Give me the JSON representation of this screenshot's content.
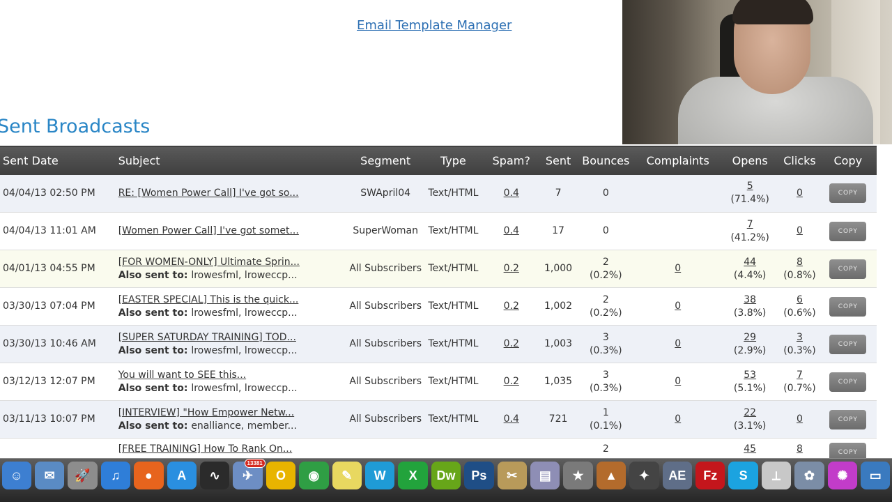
{
  "top_link": "Email Template Manager",
  "section_title": "Sent Broadcasts",
  "columns": [
    "Sent Date",
    "Subject",
    "Segment",
    "Type",
    "Spam?",
    "Sent",
    "Bounces",
    "Complaints",
    "Opens",
    "Clicks",
    "Copy"
  ],
  "copy_label": "COPY",
  "also_label": "Also sent to:",
  "rows": [
    {
      "date": "04/04/13 02:50 PM",
      "subject": "RE: [Women Power Call] I've got so...",
      "also": "",
      "segment": "SWApril04",
      "type": "Text/HTML",
      "spam": "0.4",
      "sent": "7",
      "bounces": "0",
      "bounces_pct": "",
      "complaints": "",
      "opens": "5",
      "opens_pct": "(71.4%)",
      "clicks": "0",
      "clicks_pct": "",
      "style": "odd"
    },
    {
      "date": "04/04/13 11:01 AM",
      "subject": "[Women Power Call] I've got somet...",
      "also": "",
      "segment": "SuperWoman",
      "type": "Text/HTML",
      "spam": "0.4",
      "sent": "17",
      "bounces": "0",
      "bounces_pct": "",
      "complaints": "",
      "opens": "7",
      "opens_pct": "(41.2%)",
      "clicks": "0",
      "clicks_pct": "",
      "style": "even"
    },
    {
      "date": "04/01/13 04:55 PM",
      "subject": "[FOR WOMEN-ONLY] Ultimate Sprin...",
      "also": "lrowesfml, lroweccp...",
      "segment": "All Subscribers",
      "type": "Text/HTML",
      "spam": "0.2",
      "sent": "1,000",
      "bounces": "2",
      "bounces_pct": "(0.2%)",
      "complaints": "0",
      "opens": "44",
      "opens_pct": "(4.4%)",
      "clicks": "8",
      "clicks_pct": "(0.8%)",
      "style": "hl"
    },
    {
      "date": "03/30/13 07:04 PM",
      "subject": "[EASTER SPECIAL] This is the quick...",
      "also": "lrowesfml, lroweccp...",
      "segment": "All Subscribers",
      "type": "Text/HTML",
      "spam": "0.2",
      "sent": "1,002",
      "bounces": "2",
      "bounces_pct": "(0.2%)",
      "complaints": "0",
      "opens": "38",
      "opens_pct": "(3.8%)",
      "clicks": "6",
      "clicks_pct": "(0.6%)",
      "style": "even"
    },
    {
      "date": "03/30/13 10:46 AM",
      "subject": "[SUPER SATURDAY TRAINING] TOD...",
      "also": "lrowesfml, lroweccp...",
      "segment": "All Subscribers",
      "type": "Text/HTML",
      "spam": "0.2",
      "sent": "1,003",
      "bounces": "3",
      "bounces_pct": "(0.3%)",
      "complaints": "0",
      "opens": "29",
      "opens_pct": "(2.9%)",
      "clicks": "3",
      "clicks_pct": "(0.3%)",
      "style": "odd"
    },
    {
      "date": "03/12/13 12:07 PM",
      "subject": "You will want to SEE this...",
      "also": "lrowesfml, lroweccp...",
      "segment": "All Subscribers",
      "type": "Text/HTML",
      "spam": "0.2",
      "sent": "1,035",
      "bounces": "3",
      "bounces_pct": "(0.3%)",
      "complaints": "0",
      "opens": "53",
      "opens_pct": "(5.1%)",
      "clicks": "7",
      "clicks_pct": "(0.7%)",
      "style": "even"
    },
    {
      "date": "03/11/13 10:07 PM",
      "subject": "[INTERVIEW] \"How Empower Netw...",
      "also": "enalliance, member...",
      "segment": "All Subscribers",
      "type": "Text/HTML",
      "spam": "0.4",
      "sent": "721",
      "bounces": "1",
      "bounces_pct": "(0.1%)",
      "complaints": "0",
      "opens": "22",
      "opens_pct": "(3.1%)",
      "clicks": "0",
      "clicks_pct": "",
      "style": "odd"
    },
    {
      "date": "",
      "subject": "[FREE TRAINING] How To Rank On...",
      "also": "",
      "segment": "",
      "type": "",
      "spam": "",
      "sent": "",
      "bounces": "2",
      "bounces_pct": "",
      "complaints": "",
      "opens": "45",
      "opens_pct": "",
      "clicks": "8",
      "clicks_pct": "",
      "style": "cut"
    }
  ],
  "dock": {
    "badge": "13381",
    "icons": [
      {
        "name": "finder-icon",
        "glyph": "☺",
        "color": "#3d7fd1"
      },
      {
        "name": "mail-icon",
        "glyph": "✉",
        "color": "#5a8bc4"
      },
      {
        "name": "launchpad-icon",
        "glyph": "🚀",
        "color": "#8d8d8d"
      },
      {
        "name": "itunes-icon",
        "glyph": "♫",
        "color": "#2f7ed8"
      },
      {
        "name": "firefox-icon",
        "glyph": "●",
        "color": "#e7641d"
      },
      {
        "name": "app-store-icon",
        "glyph": "A",
        "color": "#2a8fe0"
      },
      {
        "name": "activity-monitor-icon",
        "glyph": "∿",
        "color": "#2b2b2b"
      },
      {
        "name": "mail-badge-icon",
        "glyph": "✈",
        "color": "#6d8ec4"
      },
      {
        "name": "opera-icon",
        "glyph": "O",
        "color": "#e8b400"
      },
      {
        "name": "chrome-icon",
        "glyph": "◉",
        "color": "#2f9e44"
      },
      {
        "name": "stickies-icon",
        "glyph": "✎",
        "color": "#e8d860"
      },
      {
        "name": "word-icon",
        "glyph": "W",
        "color": "#1f9bd6"
      },
      {
        "name": "excel-icon",
        "glyph": "X",
        "color": "#22a33c"
      },
      {
        "name": "dreamweaver-icon",
        "glyph": "Dw",
        "color": "#67a619"
      },
      {
        "name": "photoshop-icon",
        "glyph": "Ps",
        "color": "#1f4e86"
      },
      {
        "name": "utilities-icon",
        "glyph": "✂",
        "color": "#b89a5a"
      },
      {
        "name": "preview-icon",
        "glyph": "▤",
        "color": "#8e8eb5"
      },
      {
        "name": "imovie-icon",
        "glyph": "★",
        "color": "#7a7a7a"
      },
      {
        "name": "keynote-icon",
        "glyph": "▲",
        "color": "#b36b2c"
      },
      {
        "name": "final-cut-icon",
        "glyph": "✦",
        "color": "#444444"
      },
      {
        "name": "after-effects-icon",
        "glyph": "AE",
        "color": "#5f6e88"
      },
      {
        "name": "filezilla-icon",
        "glyph": "Fz",
        "color": "#c4161c"
      },
      {
        "name": "skype-icon",
        "glyph": "S",
        "color": "#1ba3e0"
      },
      {
        "name": "acrobat-icon",
        "glyph": "⟂",
        "color": "#c8c8c8"
      },
      {
        "name": "iphoto-icon",
        "glyph": "✿",
        "color": "#7b8da6"
      },
      {
        "name": "palette-icon",
        "glyph": "✺",
        "color": "#c23cc9"
      },
      {
        "name": "screen-icon",
        "glyph": "▭",
        "color": "#3a7abf"
      }
    ]
  }
}
